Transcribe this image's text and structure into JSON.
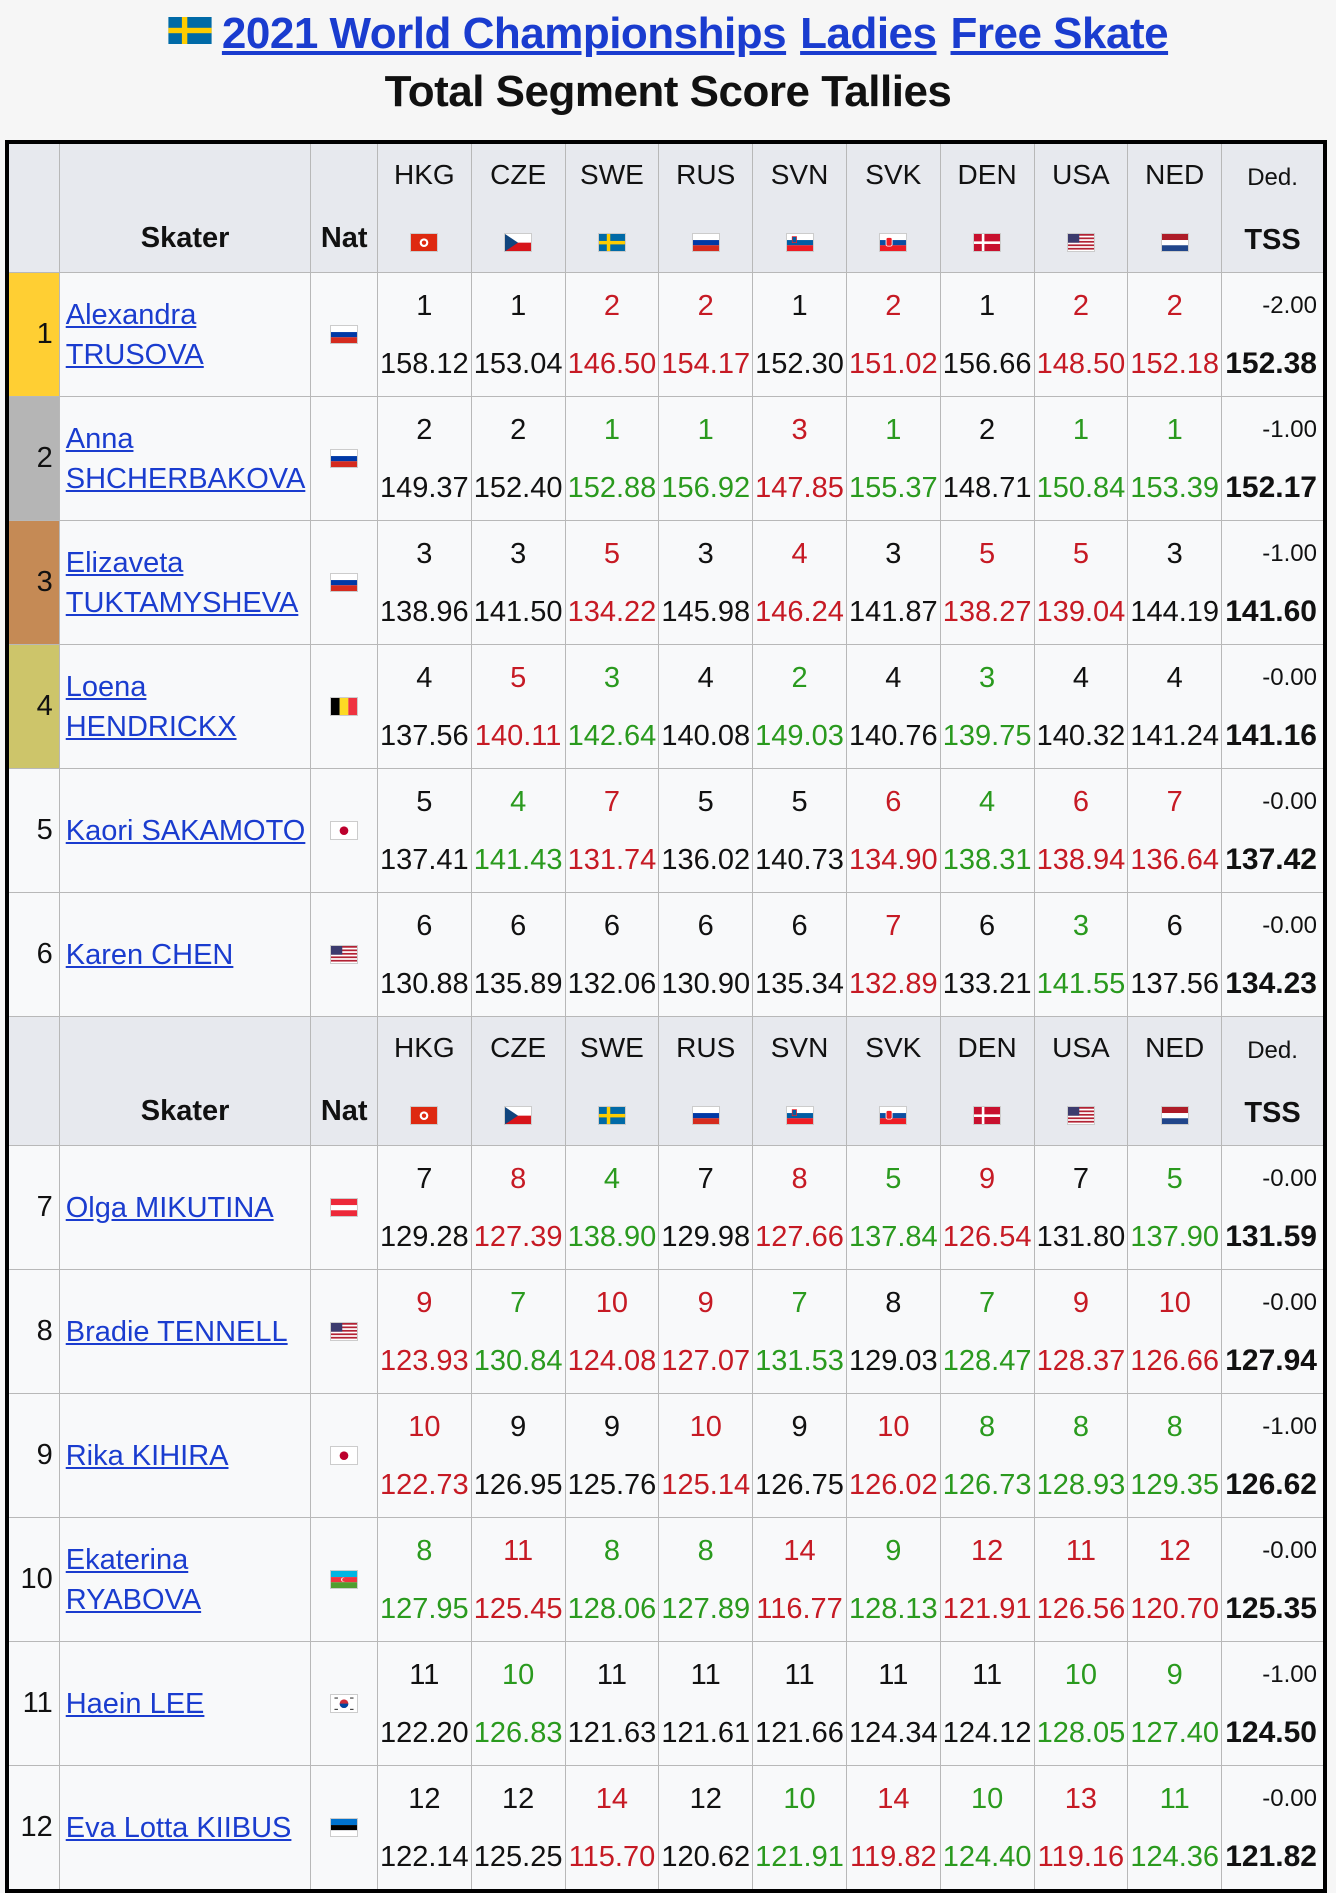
{
  "header": {
    "title_event": "2021 World Championships",
    "title_category": "Ladies",
    "title_segment": "Free Skate",
    "subtitle": "Total Segment Score Tallies"
  },
  "table_header": {
    "skater": "Skater",
    "nat": "Nat",
    "ded": "Ded.",
    "tss": "TSS",
    "judges": [
      "HKG",
      "CZE",
      "SWE",
      "RUS",
      "SVN",
      "SVK",
      "DEN",
      "USA",
      "NED"
    ]
  },
  "colors": {
    "link": "#1a3ccf",
    "red": "#c61a24",
    "green": "#2a9a1e",
    "gold": "#ffcf33",
    "silver": "#b5b5b5",
    "bronze": "#c58a55",
    "fourth": "#cdc56a"
  },
  "rows": [
    {
      "rank": "1",
      "name1": "Alexandra TRUSOVA",
      "name2": "",
      "nat": "RUS",
      "ded": "-2.00",
      "tss": "152.38",
      "scores": [
        [
          "1",
          "158.12",
          "black"
        ],
        [
          "1",
          "153.04",
          "black"
        ],
        [
          "2",
          "146.50",
          "red"
        ],
        [
          "2",
          "154.17",
          "red"
        ],
        [
          "1",
          "152.30",
          "black"
        ],
        [
          "2",
          "151.02",
          "red"
        ],
        [
          "1",
          "156.66",
          "black"
        ],
        [
          "2",
          "148.50",
          "red"
        ],
        [
          "2",
          "152.18",
          "red"
        ]
      ]
    },
    {
      "rank": "2",
      "name1": "Anna ",
      "name2": "SHCHERBAKOVA",
      "nat": "RUS",
      "ded": "-1.00",
      "tss": "152.17",
      "scores": [
        [
          "2",
          "149.37",
          "black"
        ],
        [
          "2",
          "152.40",
          "black"
        ],
        [
          "1",
          "152.88",
          "green"
        ],
        [
          "1",
          "156.92",
          "green"
        ],
        [
          "3",
          "147.85",
          "red"
        ],
        [
          "1",
          "155.37",
          "green"
        ],
        [
          "2",
          "148.71",
          "black"
        ],
        [
          "1",
          "150.84",
          "green"
        ],
        [
          "1",
          "153.39",
          "green"
        ]
      ]
    },
    {
      "rank": "3",
      "name1": "Elizaveta ",
      "name2": "TUKTAMYSHEVA",
      "nat": "RUS",
      "ded": "-1.00",
      "tss": "141.60",
      "scores": [
        [
          "3",
          "138.96",
          "black"
        ],
        [
          "3",
          "141.50",
          "black"
        ],
        [
          "5",
          "134.22",
          "red"
        ],
        [
          "3",
          "145.98",
          "black"
        ],
        [
          "4",
          "146.24",
          "red"
        ],
        [
          "3",
          "141.87",
          "black"
        ],
        [
          "5",
          "138.27",
          "red"
        ],
        [
          "5",
          "139.04",
          "red"
        ],
        [
          "3",
          "144.19",
          "black"
        ]
      ]
    },
    {
      "rank": "4",
      "name1": "Loena HENDRICKX",
      "name2": "",
      "nat": "BEL",
      "ded": "-0.00",
      "tss": "141.16",
      "scores": [
        [
          "4",
          "137.56",
          "black"
        ],
        [
          "5",
          "140.11",
          "red"
        ],
        [
          "3",
          "142.64",
          "green"
        ],
        [
          "4",
          "140.08",
          "black"
        ],
        [
          "2",
          "149.03",
          "green"
        ],
        [
          "4",
          "140.76",
          "black"
        ],
        [
          "3",
          "139.75",
          "green"
        ],
        [
          "4",
          "140.32",
          "black"
        ],
        [
          "4",
          "141.24",
          "black"
        ]
      ]
    },
    {
      "rank": "5",
      "name1": "Kaori SAKAMOTO",
      "name2": "",
      "nat": "JPN",
      "ded": "-0.00",
      "tss": "137.42",
      "scores": [
        [
          "5",
          "137.41",
          "black"
        ],
        [
          "4",
          "141.43",
          "green"
        ],
        [
          "7",
          "131.74",
          "red"
        ],
        [
          "5",
          "136.02",
          "black"
        ],
        [
          "5",
          "140.73",
          "black"
        ],
        [
          "6",
          "134.90",
          "red"
        ],
        [
          "4",
          "138.31",
          "green"
        ],
        [
          "6",
          "138.94",
          "red"
        ],
        [
          "7",
          "136.64",
          "red"
        ]
      ]
    },
    {
      "rank": "6",
      "name1": "Karen CHEN",
      "name2": "",
      "nat": "USA",
      "ded": "-0.00",
      "tss": "134.23",
      "scores": [
        [
          "6",
          "130.88",
          "black"
        ],
        [
          "6",
          "135.89",
          "black"
        ],
        [
          "6",
          "132.06",
          "black"
        ],
        [
          "6",
          "130.90",
          "black"
        ],
        [
          "6",
          "135.34",
          "black"
        ],
        [
          "7",
          "132.89",
          "red"
        ],
        [
          "6",
          "133.21",
          "black"
        ],
        [
          "3",
          "141.55",
          "green"
        ],
        [
          "6",
          "137.56",
          "black"
        ]
      ]
    },
    {
      "rank": "7",
      "name1": "Olga MIKUTINA",
      "name2": "",
      "nat": "AUT",
      "ded": "-0.00",
      "tss": "131.59",
      "scores": [
        [
          "7",
          "129.28",
          "black"
        ],
        [
          "8",
          "127.39",
          "red"
        ],
        [
          "4",
          "138.90",
          "green"
        ],
        [
          "7",
          "129.98",
          "black"
        ],
        [
          "8",
          "127.66",
          "red"
        ],
        [
          "5",
          "137.84",
          "green"
        ],
        [
          "9",
          "126.54",
          "red"
        ],
        [
          "7",
          "131.80",
          "black"
        ],
        [
          "5",
          "137.90",
          "green"
        ]
      ]
    },
    {
      "rank": "8",
      "name1": "Bradie TENNELL",
      "name2": "",
      "nat": "USA",
      "ded": "-0.00",
      "tss": "127.94",
      "scores": [
        [
          "9",
          "123.93",
          "red"
        ],
        [
          "7",
          "130.84",
          "green"
        ],
        [
          "10",
          "124.08",
          "red"
        ],
        [
          "9",
          "127.07",
          "red"
        ],
        [
          "7",
          "131.53",
          "green"
        ],
        [
          "8",
          "129.03",
          "black"
        ],
        [
          "7",
          "128.47",
          "green"
        ],
        [
          "9",
          "128.37",
          "red"
        ],
        [
          "10",
          "126.66",
          "red"
        ]
      ]
    },
    {
      "rank": "9",
      "name1": "Rika KIHIRA",
      "name2": "",
      "nat": "JPN",
      "ded": "-1.00",
      "tss": "126.62",
      "scores": [
        [
          "10",
          "122.73",
          "red"
        ],
        [
          "9",
          "126.95",
          "black"
        ],
        [
          "9",
          "125.76",
          "black"
        ],
        [
          "10",
          "125.14",
          "red"
        ],
        [
          "9",
          "126.75",
          "black"
        ],
        [
          "10",
          "126.02",
          "red"
        ],
        [
          "8",
          "126.73",
          "green"
        ],
        [
          "8",
          "128.93",
          "green"
        ],
        [
          "8",
          "129.35",
          "green"
        ]
      ]
    },
    {
      "rank": "10",
      "name1": "Ekaterina RYABOVA",
      "name2": "",
      "nat": "AZE",
      "ded": "-0.00",
      "tss": "125.35",
      "scores": [
        [
          "8",
          "127.95",
          "green"
        ],
        [
          "11",
          "125.45",
          "red"
        ],
        [
          "8",
          "128.06",
          "green"
        ],
        [
          "8",
          "127.89",
          "green"
        ],
        [
          "14",
          "116.77",
          "red"
        ],
        [
          "9",
          "128.13",
          "green"
        ],
        [
          "12",
          "121.91",
          "red"
        ],
        [
          "11",
          "126.56",
          "red"
        ],
        [
          "12",
          "120.70",
          "red"
        ]
      ]
    },
    {
      "rank": "11",
      "name1": "Haein LEE",
      "name2": "",
      "nat": "KOR",
      "ded": "-1.00",
      "tss": "124.50",
      "scores": [
        [
          "11",
          "122.20",
          "black"
        ],
        [
          "10",
          "126.83",
          "green"
        ],
        [
          "11",
          "121.63",
          "black"
        ],
        [
          "11",
          "121.61",
          "black"
        ],
        [
          "11",
          "121.66",
          "black"
        ],
        [
          "11",
          "124.34",
          "black"
        ],
        [
          "11",
          "124.12",
          "black"
        ],
        [
          "10",
          "128.05",
          "green"
        ],
        [
          "9",
          "127.40",
          "green"
        ]
      ]
    },
    {
      "rank": "12",
      "name1": "Eva Lotta KIIBUS",
      "name2": "",
      "nat": "EST",
      "ded": "-0.00",
      "tss": "121.82",
      "scores": [
        [
          "12",
          "122.14",
          "black"
        ],
        [
          "12",
          "125.25",
          "black"
        ],
        [
          "14",
          "115.70",
          "red"
        ],
        [
          "12",
          "120.62",
          "black"
        ],
        [
          "10",
          "121.91",
          "green"
        ],
        [
          "14",
          "119.82",
          "red"
        ],
        [
          "10",
          "124.40",
          "green"
        ],
        [
          "13",
          "119.16",
          "red"
        ],
        [
          "11",
          "124.36",
          "green"
        ]
      ]
    }
  ]
}
